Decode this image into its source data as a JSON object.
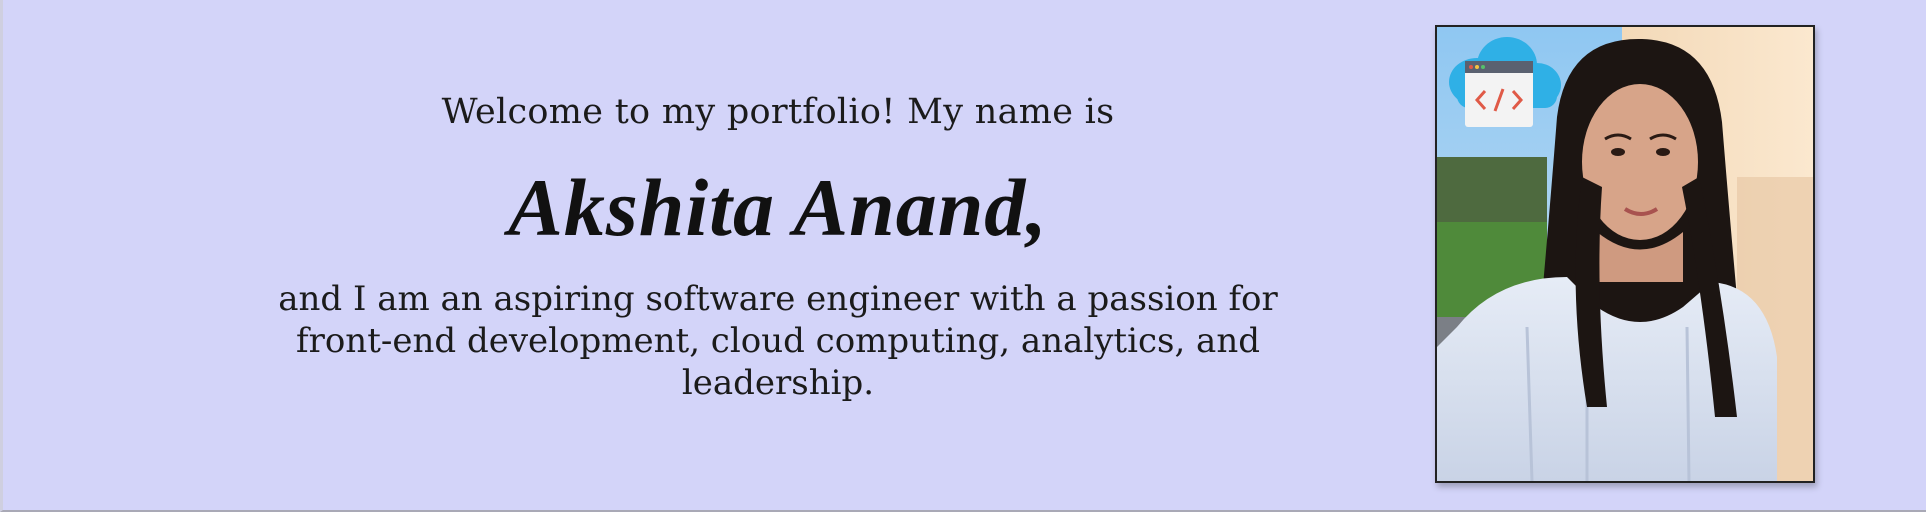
{
  "hero": {
    "welcome": "Welcome to my portfolio! My name is",
    "name": "Akshita Anand,",
    "bio": "and I am an aspiring software engineer with a passion for front-end development, cloud computing, analytics, and leadership."
  },
  "photo": {
    "icon": "cloud-code-icon",
    "subject": "profile-photo"
  },
  "colors": {
    "background": "#d3d4f9",
    "text": "#1b1b1b",
    "cloud_icon": "#2fb0e6",
    "code_accent": "#e05a47"
  }
}
